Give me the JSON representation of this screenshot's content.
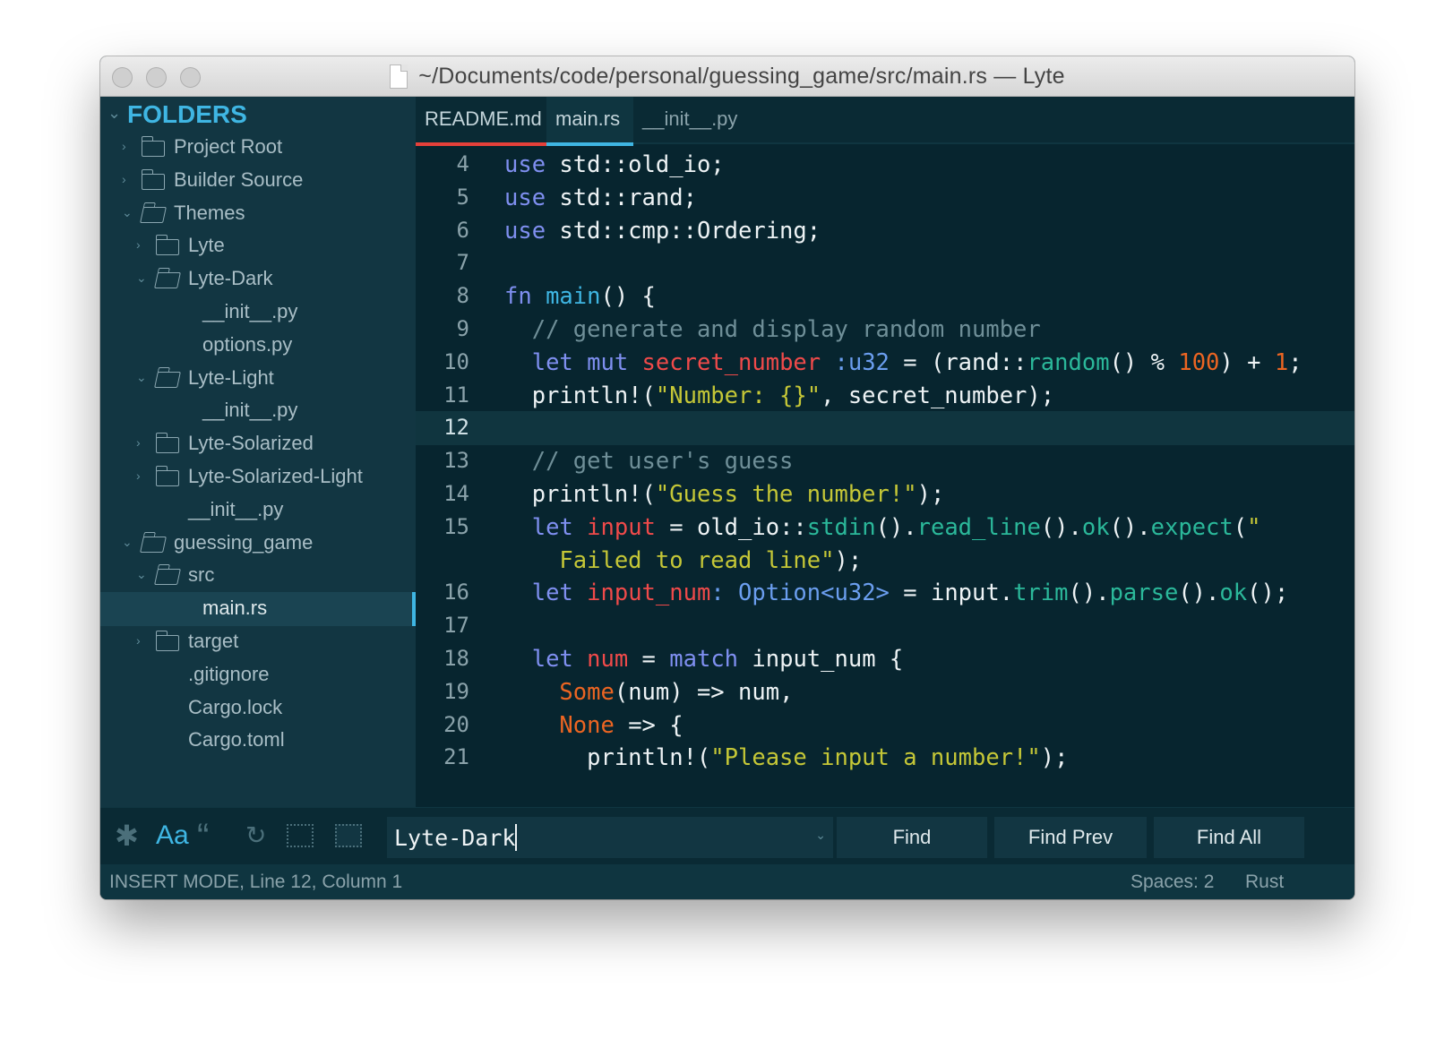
{
  "window": {
    "title": "~/Documents/code/personal/guessing_game/src/main.rs — Lyte"
  },
  "sidebar": {
    "header": "FOLDERS",
    "items": [
      {
        "label": "Project Root",
        "type": "folder",
        "state": "collapsed"
      },
      {
        "label": "Builder Source",
        "type": "folder",
        "state": "collapsed"
      },
      {
        "label": "Themes",
        "type": "folder",
        "state": "expanded"
      },
      {
        "label": "Lyte",
        "type": "folder",
        "state": "collapsed"
      },
      {
        "label": "Lyte-Dark",
        "type": "folder",
        "state": "expanded"
      },
      {
        "label": "__init__.py",
        "type": "file"
      },
      {
        "label": "options.py",
        "type": "file"
      },
      {
        "label": "Lyte-Light",
        "type": "folder",
        "state": "expanded"
      },
      {
        "label": "__init__.py",
        "type": "file"
      },
      {
        "label": "Lyte-Solarized",
        "type": "folder",
        "state": "collapsed"
      },
      {
        "label": "Lyte-Solarized-Light",
        "type": "folder",
        "state": "collapsed"
      },
      {
        "label": "__init__.py",
        "type": "file"
      },
      {
        "label": "guessing_game",
        "type": "folder",
        "state": "expanded"
      },
      {
        "label": "src",
        "type": "folder",
        "state": "expanded"
      },
      {
        "label": "main.rs",
        "type": "file",
        "selected": true
      },
      {
        "label": "target",
        "type": "folder",
        "state": "collapsed"
      },
      {
        "label": ".gitignore",
        "type": "file"
      },
      {
        "label": "Cargo.lock",
        "type": "file"
      },
      {
        "label": "Cargo.toml",
        "type": "file"
      }
    ]
  },
  "tabs": [
    {
      "label": "README.md",
      "accent": "#e5403a"
    },
    {
      "label": "main.rs",
      "accent": "#3fb6e3",
      "active": true
    },
    {
      "label": "__init__.py",
      "accent": ""
    }
  ],
  "editor": {
    "current_line": "12",
    "lines": [
      {
        "n": "4",
        "tokens": [
          [
            "kw",
            "use"
          ],
          [
            "",
            " std::old_io;"
          ]
        ]
      },
      {
        "n": "5",
        "tokens": [
          [
            "kw",
            "use"
          ],
          [
            "",
            " std::rand;"
          ]
        ]
      },
      {
        "n": "6",
        "tokens": [
          [
            "kw",
            "use"
          ],
          [
            "",
            " std::cmp::Ordering;"
          ]
        ]
      },
      {
        "n": "7",
        "tokens": []
      },
      {
        "n": "8",
        "tokens": [
          [
            "kw",
            "fn"
          ],
          [
            "",
            " "
          ],
          [
            "fn",
            "main"
          ],
          [
            "",
            "() {"
          ]
        ]
      },
      {
        "n": "9",
        "tokens": [
          [
            "",
            "  "
          ],
          [
            "com",
            "// generate and display random number"
          ]
        ]
      },
      {
        "n": "10",
        "tokens": [
          [
            "",
            "  "
          ],
          [
            "kw",
            "let mut"
          ],
          [
            "",
            " "
          ],
          [
            "var",
            "secret_number"
          ],
          [
            "",
            " "
          ],
          [
            "typ",
            ":u32"
          ],
          [
            "",
            " = (rand::"
          ],
          [
            "mtd",
            "random"
          ],
          [
            "",
            "() % "
          ],
          [
            "num",
            "100"
          ],
          [
            "",
            ") + "
          ],
          [
            "num",
            "1"
          ],
          [
            "",
            ";"
          ]
        ]
      },
      {
        "n": "11",
        "tokens": [
          [
            "",
            "  println!("
          ],
          [
            "str",
            "\"Number: {}\""
          ],
          [
            "",
            ", secret_number);"
          ]
        ]
      },
      {
        "n": "12",
        "tokens": []
      },
      {
        "n": "13",
        "tokens": [
          [
            "",
            "  "
          ],
          [
            "com",
            "// get user's guess"
          ]
        ]
      },
      {
        "n": "14",
        "tokens": [
          [
            "",
            "  println!("
          ],
          [
            "str",
            "\"Guess the number!\""
          ],
          [
            "",
            ");"
          ]
        ]
      },
      {
        "n": "15",
        "tokens": [
          [
            "",
            "  "
          ],
          [
            "kw",
            "let"
          ],
          [
            "",
            " "
          ],
          [
            "var",
            "input"
          ],
          [
            "",
            " = old_io::"
          ],
          [
            "mtd",
            "stdin"
          ],
          [
            "",
            "()."
          ],
          [
            "mtd",
            "read_line"
          ],
          [
            "",
            "()."
          ],
          [
            "mtd",
            "ok"
          ],
          [
            "",
            "()."
          ],
          [
            "mtd",
            "expect"
          ],
          [
            "",
            "("
          ],
          [
            "str",
            "\""
          ]
        ]
      },
      {
        "n": "",
        "tokens": [
          [
            "",
            "    "
          ],
          [
            "str",
            "Failed to read line\""
          ],
          [
            "",
            ");"
          ]
        ]
      },
      {
        "n": "16",
        "tokens": [
          [
            "",
            "  "
          ],
          [
            "kw",
            "let"
          ],
          [
            "",
            " "
          ],
          [
            "var",
            "input_num"
          ],
          [
            "typ",
            ": Option<u32>"
          ],
          [
            "",
            " = input."
          ],
          [
            "mtd",
            "trim"
          ],
          [
            "",
            "()."
          ],
          [
            "mtd",
            "parse"
          ],
          [
            "",
            "()."
          ],
          [
            "mtd",
            "ok"
          ],
          [
            "",
            "();"
          ]
        ]
      },
      {
        "n": "17",
        "tokens": []
      },
      {
        "n": "18",
        "tokens": [
          [
            "",
            "  "
          ],
          [
            "kw",
            "let"
          ],
          [
            "",
            " "
          ],
          [
            "var",
            "num"
          ],
          [
            "",
            " = "
          ],
          [
            "kw",
            "match"
          ],
          [
            "",
            " input_num {"
          ]
        ]
      },
      {
        "n": "19",
        "tokens": [
          [
            "",
            "    "
          ],
          [
            "enm",
            "Some"
          ],
          [
            "",
            "(num) => num,"
          ]
        ]
      },
      {
        "n": "20",
        "tokens": [
          [
            "",
            "    "
          ],
          [
            "enm",
            "None"
          ],
          [
            "",
            " => {"
          ]
        ]
      },
      {
        "n": "21",
        "tokens": [
          [
            "",
            "      println!("
          ],
          [
            "str",
            "\"Please input a number!\""
          ],
          [
            "",
            ");"
          ]
        ]
      }
    ]
  },
  "findbar": {
    "icons": [
      "regex-icon",
      "case-sensitive-icon",
      "whole-word-icon",
      "wrap-icon",
      "in-selection-icon",
      "highlight-matches-icon"
    ],
    "case_label": "Aa",
    "quote_label": "“",
    "regex_label": "✱",
    "wrap_label": "↻",
    "query": "Lyte-Dark",
    "find_label": "Find",
    "find_prev_label": "Find Prev",
    "find_all_label": "Find All"
  },
  "statusbar": {
    "mode": "INSERT MODE, Line 12, Column 1",
    "indent": "Spaces: 2",
    "syntax": "Rust"
  },
  "colors": {
    "accent": "#3fb6e3",
    "sidebar_bg": "#123642",
    "editor_bg": "#07252f"
  }
}
